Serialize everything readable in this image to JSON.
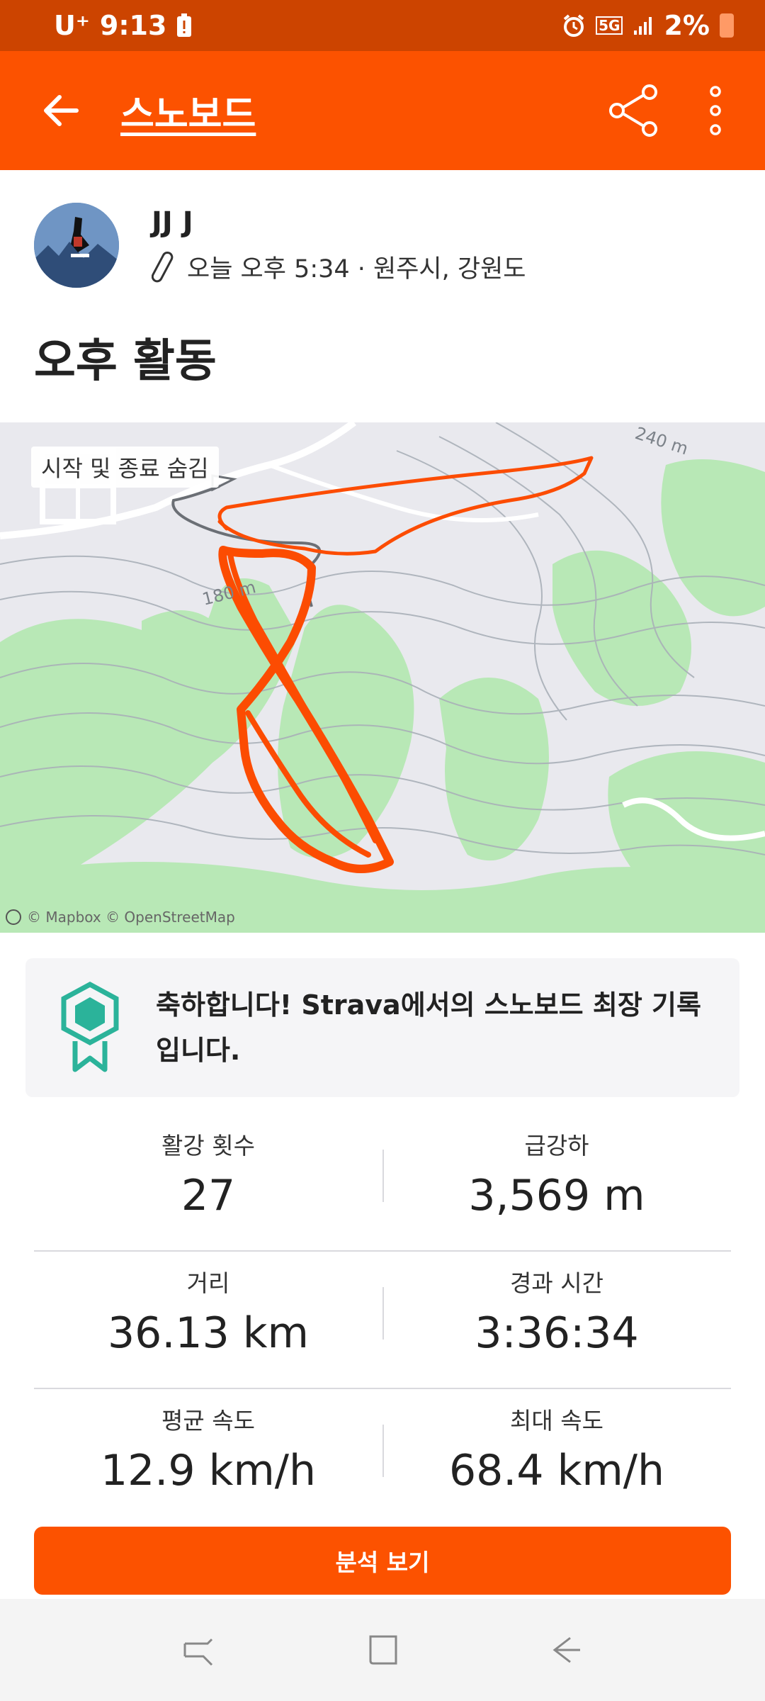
{
  "status_bar": {
    "carrier": "U⁺",
    "time": "9:13",
    "network": "5G",
    "battery": "2%"
  },
  "app_bar": {
    "title": "스노보드"
  },
  "athlete": {
    "name": "JJ J",
    "meta": "오늘 오후 5:34 · 원주시, 강원도"
  },
  "activity": {
    "title": "오후 활동"
  },
  "map": {
    "hide_label": "시작 및 종료 숨김",
    "contour_label_1": "180 m",
    "contour_label_2": "240 m",
    "attribution": "© Mapbox © OpenStreetMap",
    "route_color": "#fc4c02"
  },
  "achievement": {
    "text": "축하합니다! Strava에서의 스노보드 최장 기록입니다.",
    "badge_color": "#2bb39a"
  },
  "stats": {
    "runs_label": "활강 횟수",
    "runs_value": "27",
    "descent_label": "급강하",
    "descent_value": "3,569 m",
    "distance_label": "거리",
    "distance_value": "36.13 km",
    "elapsed_label": "경과 시간",
    "elapsed_value": "3:36:34",
    "avg_speed_label": "평균 속도",
    "avg_speed_value": "12.9 km/h",
    "max_speed_label": "최대 속도",
    "max_speed_value": "68.4 km/h"
  },
  "actions": {
    "analysis_label": "분석 보기"
  },
  "colors": {
    "brand": "#fc5200",
    "status_bar": "#cc4400"
  }
}
